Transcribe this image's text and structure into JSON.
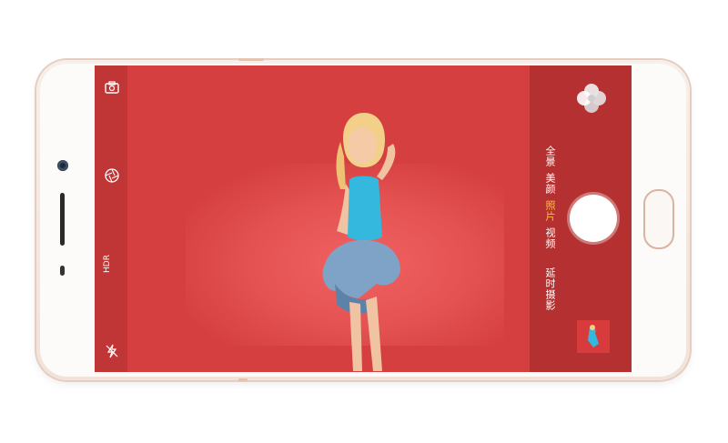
{
  "device": {
    "model_type": "smartphone-landscape",
    "frame_color": "#efe3da",
    "accent_color": "#d8b4a1"
  },
  "camera_app": {
    "left_toolbar": [
      {
        "id": "switch-camera",
        "icon": "switch-camera-icon",
        "label": ""
      },
      {
        "id": "filter",
        "icon": "aperture-icon",
        "label": ""
      },
      {
        "id": "hdr",
        "icon": "hdr-icon",
        "label": "HDR"
      },
      {
        "id": "flash",
        "icon": "flash-off-icon",
        "label": ""
      }
    ],
    "filter_menu_icon": "flower-filter-icon",
    "modes": [
      {
        "label": "延时摄影",
        "active": false
      },
      {
        "label": "视频",
        "active": false
      },
      {
        "label": "照片",
        "active": true
      },
      {
        "label": "美颜",
        "active": false
      },
      {
        "label": "全景",
        "active": false
      }
    ],
    "active_mode_color": "#f7c233",
    "viewfinder_bg": "#d53f3f"
  }
}
